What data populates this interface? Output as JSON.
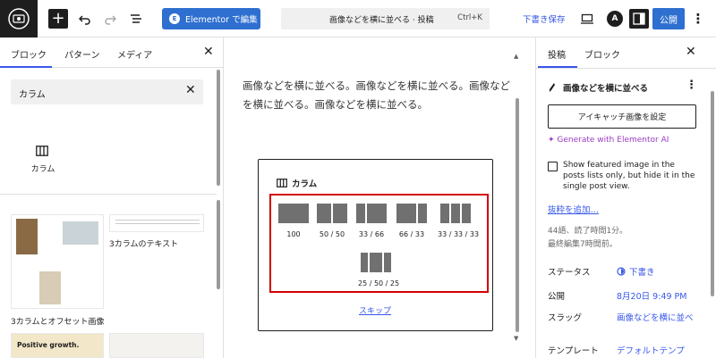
{
  "topbar": {
    "elementor_label": "Elementor で編集",
    "doc_title": "画像などを横に並べる · 投稿",
    "doc_shortcut": "Ctrl+K",
    "draft_save": "下書き保存",
    "publish": "公開",
    "astra": "A"
  },
  "left_panel": {
    "tabs": [
      "ブロック",
      "パターン",
      "メディア"
    ],
    "search_value": "カラム",
    "block_label": "カラム",
    "patterns": [
      {
        "label": "3カラムとオフセット画像"
      },
      {
        "label": "3カラムのテキスト"
      }
    ],
    "pattern_text": "Positive growth."
  },
  "canvas": {
    "paragraph": "画像などを横に並べる。画像などを横に並べる。画像などを横に並べる。画像などを横に並べる。",
    "columns_title": "カラム",
    "variations": [
      {
        "label": "100"
      },
      {
        "label": "50 / 50"
      },
      {
        "label": "33 / 66"
      },
      {
        "label": "66 / 33"
      },
      {
        "label": "33 / 33 / 33"
      },
      {
        "label": "25 / 50 / 25"
      }
    ],
    "skip": "スキップ"
  },
  "right_panel": {
    "tabs": [
      "投稿",
      "ブロック"
    ],
    "post_title": "画像などを横に並べる",
    "featured_image_btn": "アイキャッチ画像を設定",
    "generate_ai": "✦ Generate with Elementor AI",
    "checkbox_label": "Show featured image in the posts lists only, but hide it in the single post view.",
    "excerpt_link": "抜粋を追加…",
    "word_count": "44語、読了時間1分。",
    "last_edited": "最終編集7時間前。",
    "rows": [
      {
        "label": "ステータス",
        "value": "下書き"
      },
      {
        "label": "公開",
        "value": "8月20日 9:49 PM"
      },
      {
        "label": "スラッグ",
        "value": "画像などを横に並べ"
      },
      {
        "label": "テンプレート",
        "value": "デフォルトテンプ"
      }
    ]
  },
  "colors": {
    "accent": "#3858e9",
    "brand_button": "#2e6fd0",
    "highlight": "#d10000"
  }
}
